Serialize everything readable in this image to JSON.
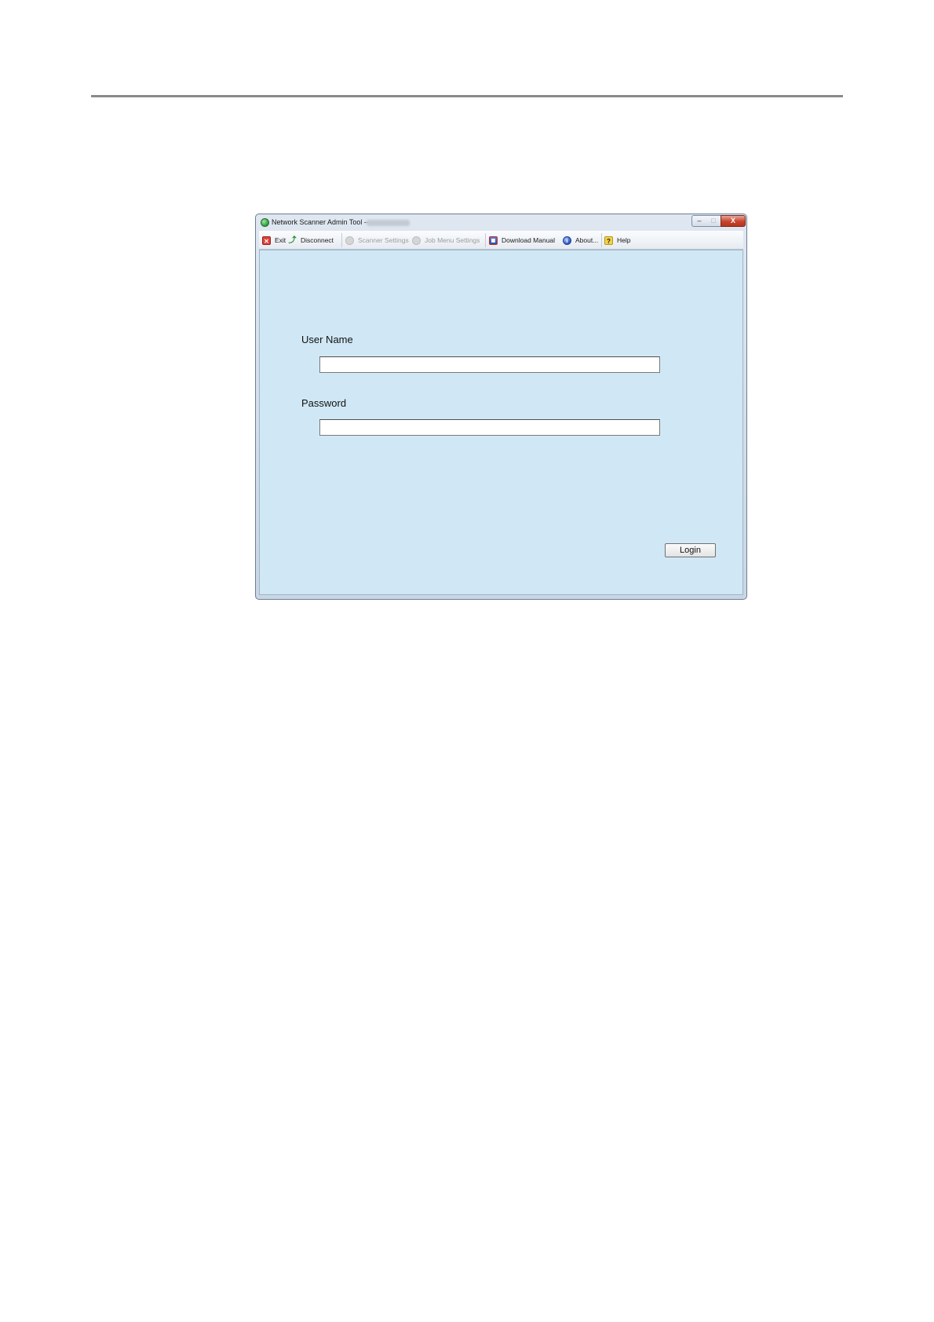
{
  "window": {
    "title": "Network Scanner Admin Tool -----",
    "controls": {
      "minimize": "–",
      "maximize": "□",
      "close": "X"
    }
  },
  "toolbar": {
    "items": [
      {
        "label": "Exit",
        "icon": "exit-icon",
        "enabled": true
      },
      {
        "label": "Disconnect",
        "icon": "disconnect-icon",
        "enabled": true
      },
      {
        "label": "Scanner Settings",
        "icon": "scanner-settings-icon",
        "enabled": false
      },
      {
        "label": "Job Menu Settings",
        "icon": "job-menu-settings-icon",
        "enabled": false
      },
      {
        "label": "Download Manual",
        "icon": "manual-icon",
        "enabled": true
      },
      {
        "label": "About...",
        "icon": "about-icon",
        "enabled": true
      },
      {
        "label": "Help",
        "icon": "help-icon",
        "enabled": true
      }
    ]
  },
  "login_form": {
    "username_label": "User Name",
    "username_value": "",
    "password_label": "Password",
    "password_value": "",
    "login_button": "Login"
  },
  "colors": {
    "client_background": "#d0e8f5",
    "page_rule": "#8a8a8a"
  }
}
